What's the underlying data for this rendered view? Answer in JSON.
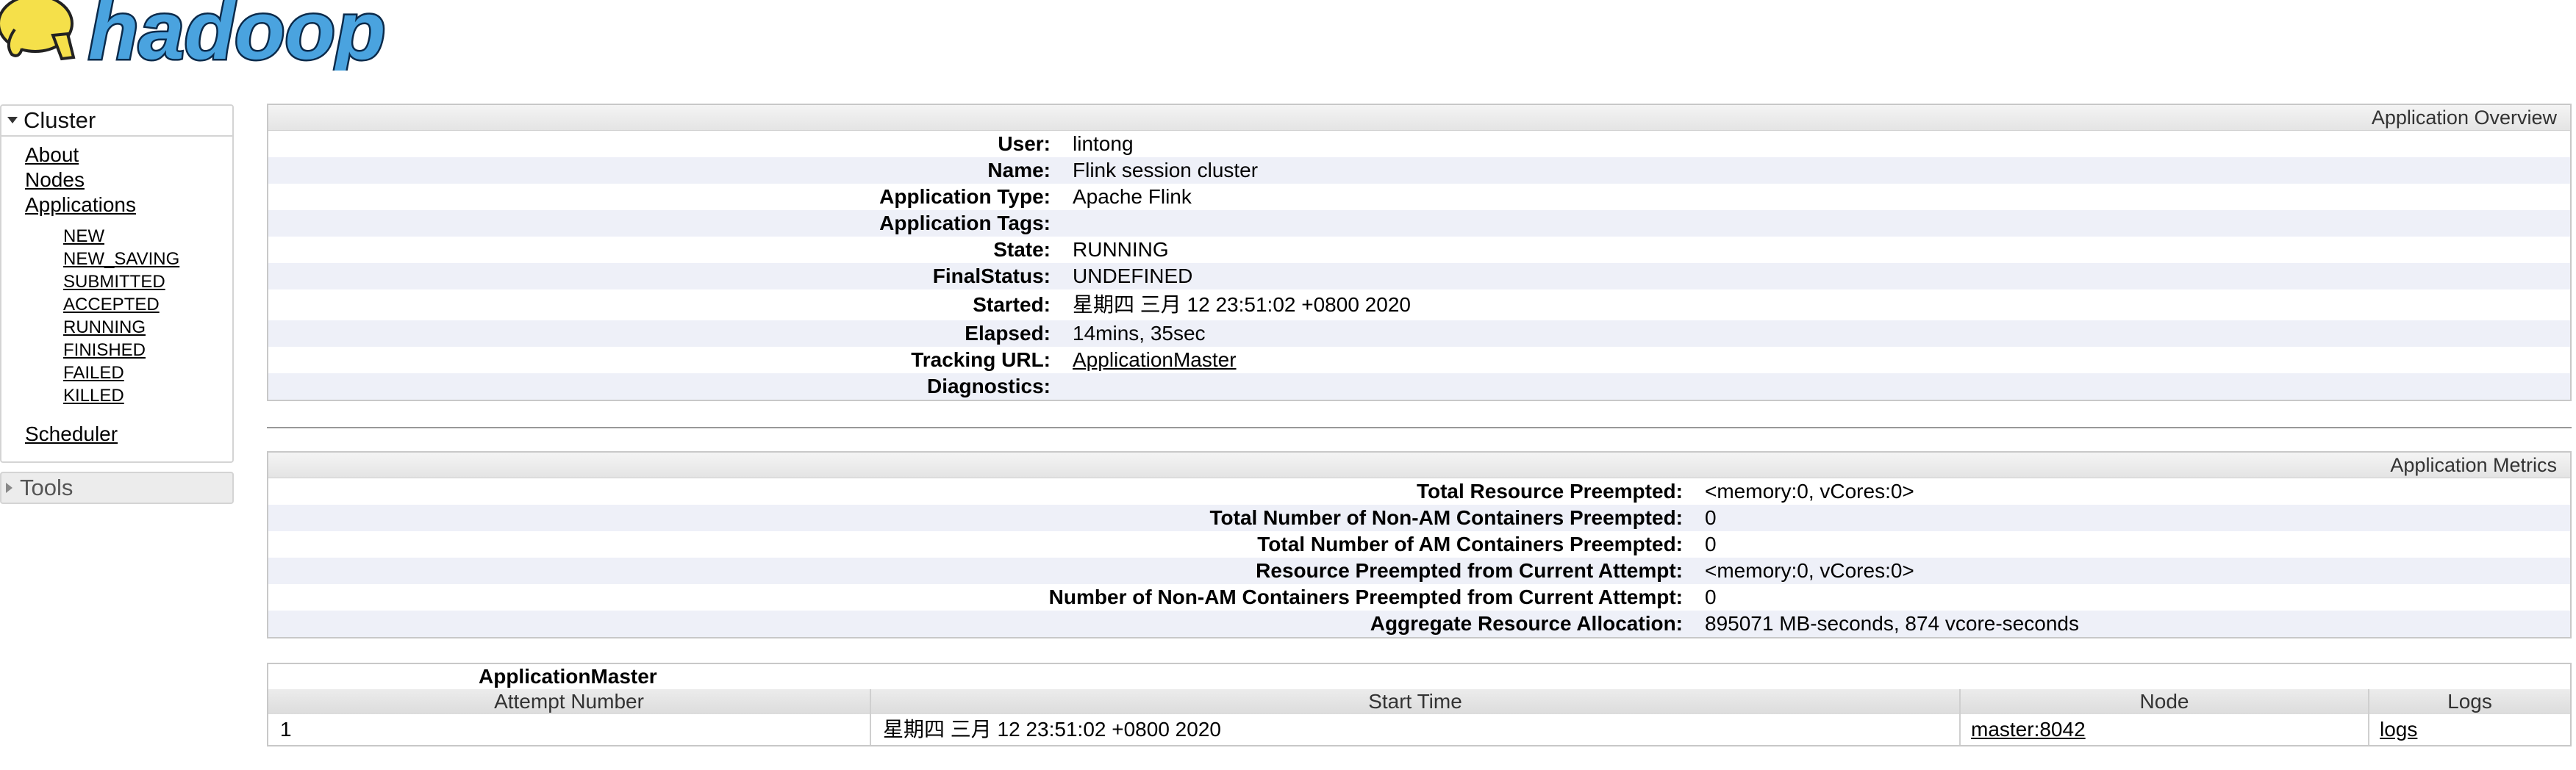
{
  "logo": {
    "text": "hadoop"
  },
  "sidebar": {
    "cluster_label": "Cluster",
    "links": [
      "About",
      "Nodes",
      "Applications"
    ],
    "app_states": [
      "NEW",
      "NEW_SAVING",
      "SUBMITTED",
      "ACCEPTED",
      "RUNNING",
      "FINISHED",
      "FAILED",
      "KILLED"
    ],
    "scheduler_label": "Scheduler",
    "tools_label": "Tools"
  },
  "overview": {
    "title": "Application Overview",
    "rows": [
      {
        "label": "User:",
        "value": "lintong"
      },
      {
        "label": "Name:",
        "value": "Flink session cluster"
      },
      {
        "label": "Application Type:",
        "value": "Apache Flink"
      },
      {
        "label": "Application Tags:",
        "value": ""
      },
      {
        "label": "State:",
        "value": "RUNNING"
      },
      {
        "label": "FinalStatus:",
        "value": "UNDEFINED"
      },
      {
        "label": "Started:",
        "value": "星期四 三月 12 23:51:02 +0800 2020"
      },
      {
        "label": "Elapsed:",
        "value": "14mins, 35sec"
      },
      {
        "label": "Tracking URL:",
        "value": "ApplicationMaster",
        "link": true
      },
      {
        "label": "Diagnostics:",
        "value": ""
      }
    ]
  },
  "metrics": {
    "title": "Application Metrics",
    "rows": [
      {
        "label": "Total Resource Preempted:",
        "value": "<memory:0, vCores:0>"
      },
      {
        "label": "Total Number of Non-AM Containers Preempted:",
        "value": "0"
      },
      {
        "label": "Total Number of AM Containers Preempted:",
        "value": "0"
      },
      {
        "label": "Resource Preempted from Current Attempt:",
        "value": "<memory:0, vCores:0>"
      },
      {
        "label": "Number of Non-AM Containers Preempted from Current Attempt:",
        "value": "0"
      },
      {
        "label": "Aggregate Resource Allocation:",
        "value": "895071 MB-seconds, 874 vcore-seconds"
      }
    ]
  },
  "app_master": {
    "title": "ApplicationMaster",
    "columns": [
      "Attempt Number",
      "Start Time",
      "Node",
      "Logs"
    ],
    "rows": [
      {
        "attempt": "1",
        "start_time": "星期四 三月 12 23:51:02 +0800 2020",
        "node": "master:8042",
        "logs": "logs"
      }
    ]
  }
}
